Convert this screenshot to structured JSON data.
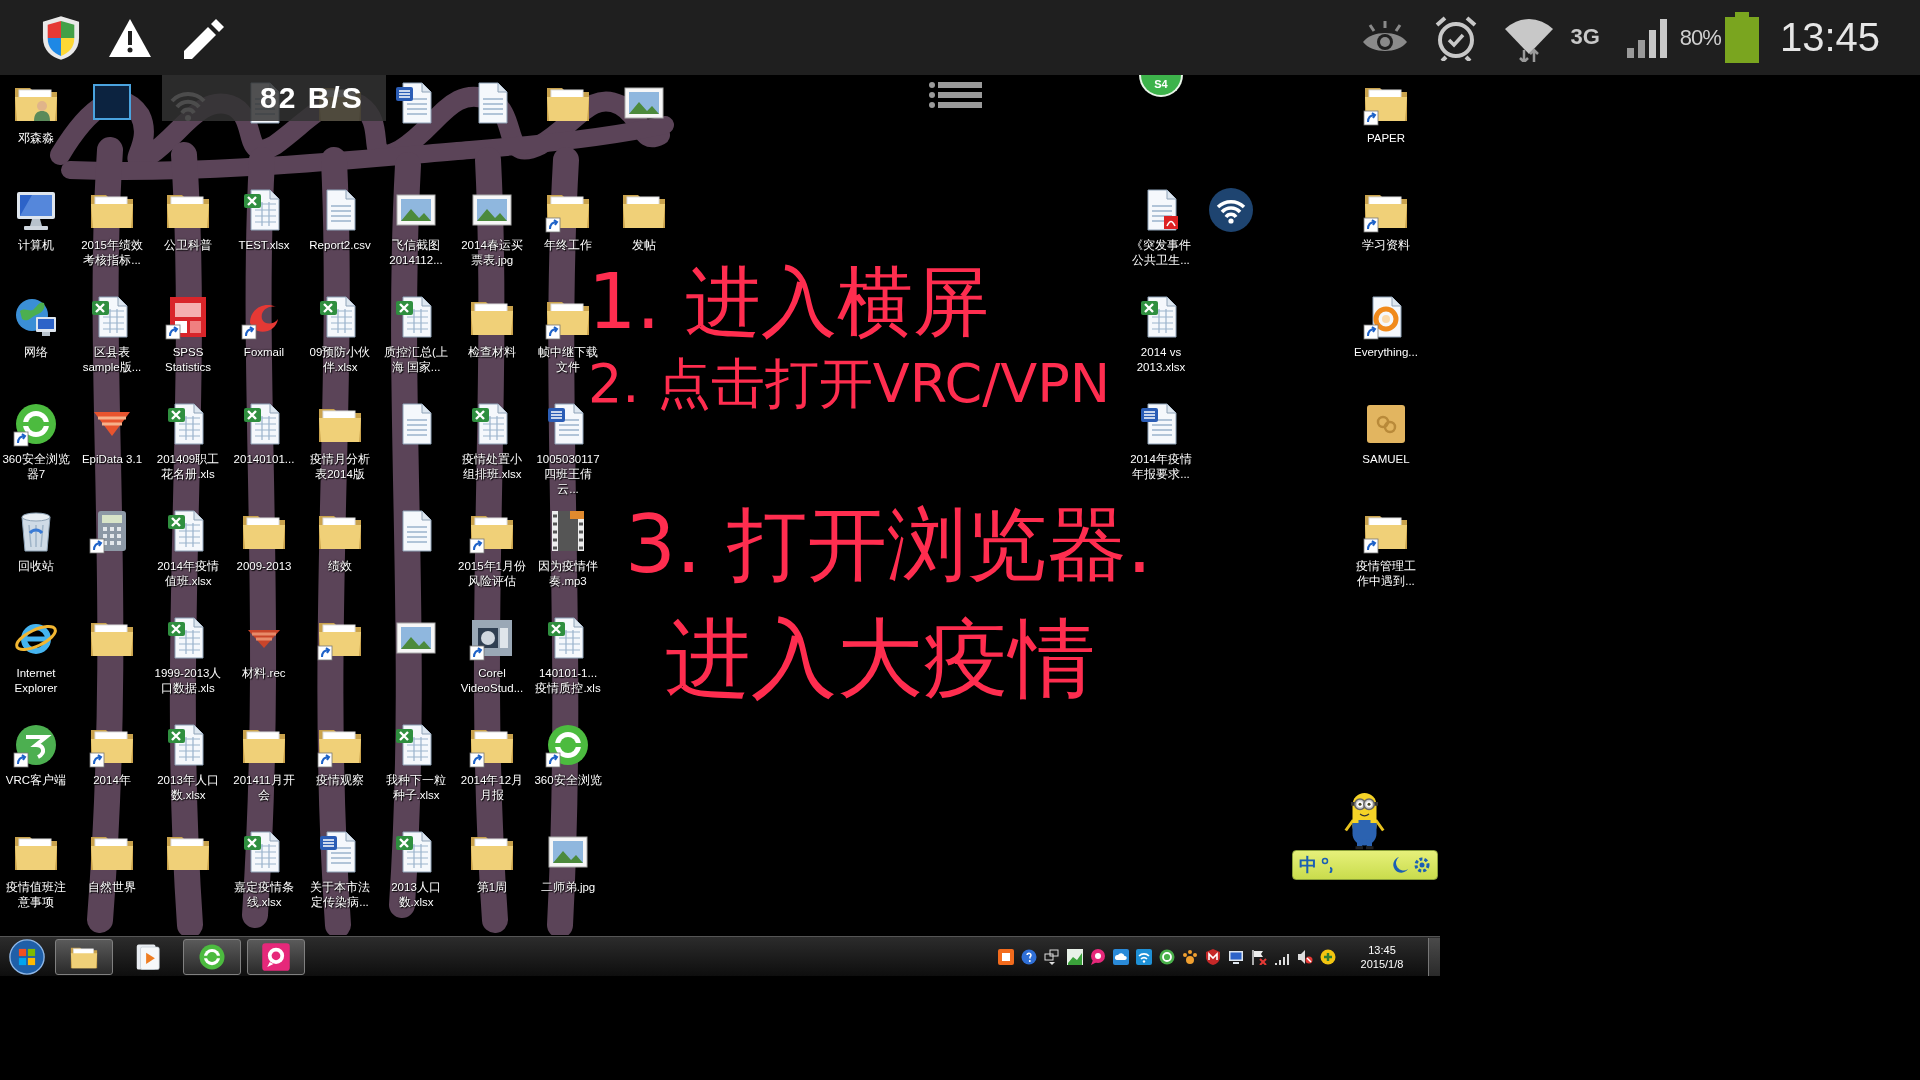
{
  "status_bar": {
    "network_type": "3G",
    "battery_percent": "80%",
    "time": "13:45"
  },
  "remote_toolbar": {
    "speed": "82 B/S"
  },
  "floating_badge": {
    "label": "S4"
  },
  "desktop": {
    "rows": [
      [
        {
          "label": "邓森淼",
          "kind": "userfolder",
          "shortcut": false
        },
        {
          "kind": "photoshop",
          "shortcut": false
        },
        {
          "kind": "broadband",
          "shortcut": false
        },
        {
          "kind": "page",
          "shortcut": false
        },
        {
          "kind": "folder",
          "shortcut": false
        },
        {
          "kind": "wordfile",
          "shortcut": false
        },
        {
          "kind": "page",
          "shortcut": false
        },
        {
          "kind": "folder",
          "shortcut": false
        },
        {
          "kind": "image",
          "shortcut": false
        }
      ],
      [
        {
          "label": "计算机",
          "kind": "computer",
          "shortcut": false
        },
        {
          "label": "2015年绩效考核指标...",
          "kind": "folder",
          "shortcut": false
        },
        {
          "label": "公卫科普",
          "kind": "folder",
          "shortcut": false
        },
        {
          "label": "TEST.xlsx",
          "kind": "sheet",
          "shortcut": false
        },
        {
          "label": "Report2.csv",
          "kind": "page",
          "shortcut": false
        },
        {
          "label": "飞信截图2014112...",
          "kind": "image",
          "shortcut": false
        },
        {
          "label": "2014春运买票表.jpg",
          "kind": "image",
          "shortcut": false
        },
        {
          "label": "年终工作",
          "kind": "folder",
          "shortcut": true
        },
        {
          "label": "发帖",
          "kind": "folder",
          "shortcut": false
        }
      ],
      [
        {
          "label": "网络",
          "kind": "network",
          "shortcut": false
        },
        {
          "label": "区县表sample版...",
          "kind": "sheet",
          "shortcut": false
        },
        {
          "label": "SPSS Statistics",
          "kind": "spss",
          "shortcut": true
        },
        {
          "label": "Foxmail",
          "kind": "foxmail",
          "shortcut": true
        },
        {
          "label": "09预防小伙伴.xlsx",
          "kind": "sheet",
          "shortcut": false
        },
        {
          "label": "质控汇总(上海 国家...",
          "kind": "sheet",
          "shortcut": false
        },
        {
          "label": "检查材料",
          "kind": "folder",
          "shortcut": false
        },
        {
          "label": "帧中继下载文件",
          "kind": "folder",
          "shortcut": true
        }
      ],
      [
        {
          "label": "360安全浏览器7",
          "kind": "browser360",
          "shortcut": true
        },
        {
          "label": "EpiData 3.1",
          "kind": "epidata",
          "shortcut": false
        },
        {
          "label": "201409职工花名册.xls",
          "kind": "sheet",
          "shortcut": false
        },
        {
          "label": "20140101...",
          "kind": "sheet",
          "shortcut": false
        },
        {
          "label": "疫情月分析表2014版",
          "kind": "folder",
          "shortcut": false
        },
        {
          "kind": "page",
          "shortcut": false
        },
        {
          "label": "疫情处置小组排班.xlsx",
          "kind": "sheet",
          "shortcut": false
        },
        {
          "label": "1005030117四班王倩云...",
          "kind": "wordfile",
          "shortcut": false
        }
      ],
      [
        {
          "label": "回收站",
          "kind": "bin",
          "shortcut": false
        },
        {
          "kind": "calc",
          "shortcut": true
        },
        {
          "label": "2014年疫情值班.xlsx",
          "kind": "sheet",
          "shortcut": false
        },
        {
          "label": "2009-2013",
          "kind": "folder",
          "shortcut": false
        },
        {
          "label": "绩效",
          "kind": "folder",
          "shortcut": false
        },
        {
          "kind": "page",
          "shortcut": false
        },
        {
          "label": "2015年1月份风险评估",
          "kind": "folder",
          "shortcut": true
        },
        {
          "label": "因为疫情伴奏.mp3",
          "kind": "audio",
          "shortcut": false
        }
      ],
      [
        {
          "label": "Internet Explorer",
          "kind": "ie",
          "shortcut": false
        },
        {
          "kind": "folder",
          "shortcut": false
        },
        {
          "label": "1999-2013人口数据.xls",
          "kind": "sheet",
          "shortcut": false
        },
        {
          "label": "材料.rec",
          "kind": "record",
          "shortcut": false
        },
        {
          "kind": "folder",
          "shortcut": true
        },
        {
          "kind": "image",
          "shortcut": false
        },
        {
          "label": "Corel VideoStud...",
          "kind": "corel",
          "shortcut": true
        },
        {
          "label": "140101-1...疫情质控.xls",
          "kind": "sheet",
          "shortcut": false
        }
      ],
      [
        {
          "label": "VRC客户端",
          "kind": "vrc",
          "shortcut": true
        },
        {
          "label": "2014年",
          "kind": "folder",
          "shortcut": true
        },
        {
          "label": "2013年人口数.xlsx",
          "kind": "sheet",
          "shortcut": false
        },
        {
          "label": "201411月开会",
          "kind": "folder",
          "shortcut": false
        },
        {
          "label": "疫情观察",
          "kind": "folder",
          "shortcut": true
        },
        {
          "label": "我种下一粒种子.xlsx",
          "kind": "sheet",
          "shortcut": false
        },
        {
          "label": "2014年12月月报",
          "kind": "folder",
          "shortcut": true
        },
        {
          "label": "360安全浏览",
          "kind": "browser360",
          "shortcut": true
        }
      ],
      [
        {
          "label": "疫情值班注意事项",
          "kind": "folder",
          "shortcut": false
        },
        {
          "label": "自然世界",
          "kind": "folder",
          "shortcut": false
        },
        {
          "kind": "folder",
          "shortcut": false
        },
        {
          "label": "嘉定疫情条线.xlsx",
          "kind": "sheet",
          "shortcut": false
        },
        {
          "label": "关于本市法定传染病...",
          "kind": "wordfile",
          "shortcut": false
        },
        {
          "label": "2013人口数.xlsx",
          "kind": "sheet",
          "shortcut": false
        },
        {
          "label": "第1周",
          "kind": "folder",
          "shortcut": false
        },
        {
          "label": "二师弟.jpg",
          "kind": "image",
          "shortcut": false
        }
      ]
    ],
    "right_group": [
      [
        {
          "label": "《突发事件公共卫生...",
          "kind": "pdf",
          "shortcut": false
        },
        {
          "kind": "wifidisc",
          "shortcut": false
        }
      ],
      [
        {
          "label": "2014 vs 2013.xlsx",
          "kind": "sheet",
          "shortcut": false
        }
      ],
      [
        {
          "label": "2014年疫情年报要求...",
          "kind": "wordfile",
          "shortcut": false
        }
      ]
    ],
    "far_right_column": [
      {
        "label": "PAPER",
        "kind": "folder",
        "shortcut": true
      },
      {
        "label": "学习资料",
        "kind": "folder",
        "shortcut": true
      },
      {
        "label": "Everything...",
        "kind": "everything",
        "shortcut": true
      },
      {
        "label": "SAMUEL",
        "kind": "archive",
        "shortcut": false
      },
      {
        "label": "疫情管理工作中遇到...",
        "kind": "folder",
        "shortcut": true
      }
    ]
  },
  "annotations": [
    {
      "text": "1. 进入横屏"
    },
    {
      "text": "2. 点击打开VRC/VPN"
    },
    {
      "text": "3. 打开浏览器."
    },
    {
      "text": "进入大疫情"
    }
  ],
  "language_bar": {
    "mode": "中"
  },
  "taskbar": {
    "apps": [
      {
        "kind": "folder",
        "running": true
      },
      {
        "kind": "player",
        "running": false
      },
      {
        "kind": "browser",
        "running": true
      },
      {
        "kind": "chat",
        "running": true
      }
    ],
    "clock_time": "13:45",
    "clock_date": "2015/1/8"
  }
}
